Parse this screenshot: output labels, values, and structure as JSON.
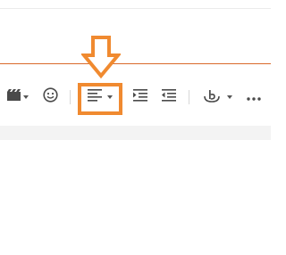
{
  "colors": {
    "accent": "#f08a30",
    "accent_line": "#d9692a",
    "icon": "#4a4a4a"
  },
  "toolbar": {
    "items": [
      {
        "name": "media-button",
        "icon": "clapperboard-icon",
        "has_dropdown": true
      },
      {
        "name": "emoji-button",
        "icon": "smiley-icon",
        "has_dropdown": false
      },
      {
        "name": "align-button",
        "icon": "align-left-icon",
        "has_dropdown": true,
        "highlighted": true
      },
      {
        "name": "indent-button",
        "icon": "indent-icon",
        "has_dropdown": false
      },
      {
        "name": "outdent-button",
        "icon": "outdent-icon",
        "has_dropdown": false
      },
      {
        "name": "special-format-button",
        "icon": "format-b-icon",
        "has_dropdown": true
      },
      {
        "name": "more-button",
        "icon": "ellipsis-icon",
        "has_dropdown": false
      }
    ]
  }
}
